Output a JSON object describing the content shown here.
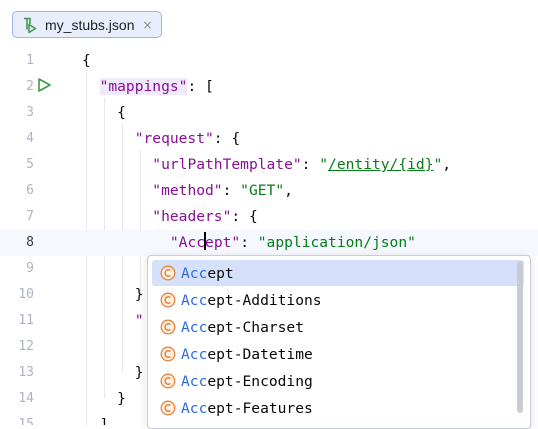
{
  "tab": {
    "label": "my_stubs.json",
    "close_glyph": "×",
    "icon": "json-stub-file-icon"
  },
  "editor": {
    "current_line": 8,
    "lines": [
      {
        "num": "1"
      },
      {
        "num": "2"
      },
      {
        "num": "3"
      },
      {
        "num": "4"
      },
      {
        "num": "5"
      },
      {
        "num": "6"
      },
      {
        "num": "7"
      },
      {
        "num": "8"
      },
      {
        "num": "9"
      },
      {
        "num": "10"
      },
      {
        "num": "11"
      },
      {
        "num": "12"
      },
      {
        "num": "13"
      },
      {
        "num": "14"
      },
      {
        "num": "15"
      }
    ],
    "text": {
      "open_brace": "{",
      "close_brace": "}",
      "close_bracket": "]",
      "quote": "\"",
      "mappings_key": "\"mappings\"",
      "colon_bracket": ": [",
      "request_key": "\"request\"",
      "colon_brace": ": {",
      "urlPathTemplate_key": "\"urlPathTemplate\"",
      "colon_space": ": ",
      "url_open_quote": "\"",
      "url_value": "/entity/{id}",
      "url_close_quote": "\"",
      "comma": ",",
      "method_key": "\"method\"",
      "method_value": "\"GET\"",
      "headers_key": "\"headers\"",
      "accept_before_caret": "\"Acc",
      "accept_after_caret": "ept\"",
      "accept_value": "\"application/json\""
    }
  },
  "completion": {
    "typed_prefix": "Acc",
    "items": [
      {
        "rest": "ept"
      },
      {
        "rest": "ept-Additions"
      },
      {
        "rest": "ept-Charset"
      },
      {
        "rest": "ept-Datetime"
      },
      {
        "rest": "ept-Encoding"
      },
      {
        "rest": "ept-Features"
      }
    ],
    "selected_index": 0
  },
  "colors": {
    "key": "#871094",
    "string": "#067d17",
    "match": "#2f6bdc",
    "selection": "#d5e1fb",
    "run_icon": "#3d9a47",
    "item_icon": "#e8823a"
  }
}
